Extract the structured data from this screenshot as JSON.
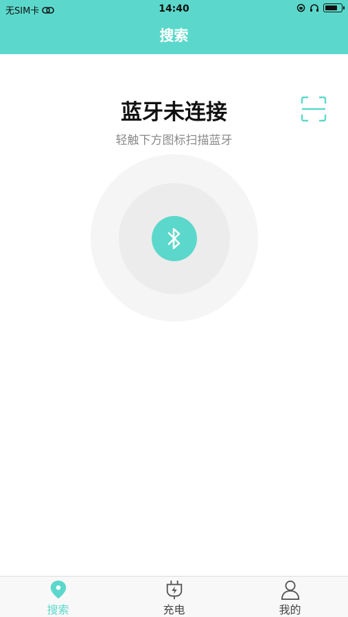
{
  "status_bar": {
    "carrier": "无SIM卡",
    "time": "14:40",
    "battery_level": 0.8
  },
  "header": {
    "title": "搜索"
  },
  "main": {
    "heading": "蓝牙未连接",
    "subtitle": "轻触下方图标扫描蓝牙",
    "scan_icon": "scan-frame-icon",
    "bluetooth_icon": "bluetooth-icon"
  },
  "tabbar": {
    "items": [
      {
        "label": "搜索",
        "icon": "location-pin-icon",
        "active": true
      },
      {
        "label": "充电",
        "icon": "plug-icon",
        "active": false
      },
      {
        "label": "我的",
        "icon": "person-icon",
        "active": false
      }
    ]
  },
  "colors": {
    "accent": "#5bd8cb",
    "tab_inactive": "#444444",
    "subtitle": "#8a8a8a",
    "outer_ring": "#f5f5f5",
    "inner_ring": "#ececec"
  }
}
